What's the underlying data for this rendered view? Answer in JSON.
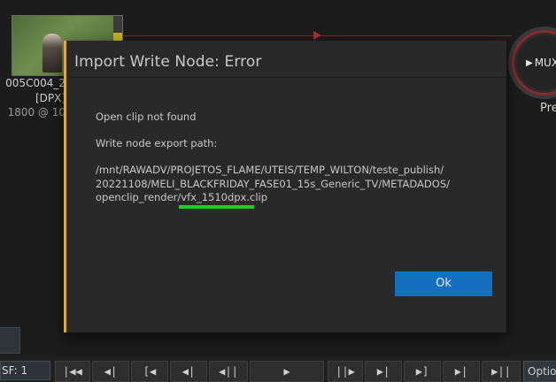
{
  "background": {
    "node_label_line1": "005C004_2",
    "node_label_line2": "[DPX]",
    "node_label_line3": "1800 @ 10",
    "mux_label": "MUX",
    "pre_label": "Pre"
  },
  "dialog": {
    "title": "Import Write Node: Error",
    "message": "Open clip not found",
    "path_label": "Write node export path:",
    "path_line1": "/mnt/RAWADV/PROJETOS_FLAME/UTEIS/TEMP_WILTON/teste_publish/",
    "path_line2": "20221108/MELI_BLACKFRIDAY_FASE01_15s_Generic_TV/METADADOS/",
    "path_line3": "openclip_render/vfx_1510dpx.clip",
    "ok_label": "Ok",
    "accent_color": "#e1a741",
    "ok_color": "#1370c1",
    "highlight_color": "#15d615"
  },
  "transport": {
    "sf_field": "SF: 1",
    "buttons": [
      "|◀◀",
      "◀|",
      "[◀",
      "◀|",
      "◀||",
      "▶",
      "||▶",
      "▶|",
      "▶]",
      "▶|",
      "▶||"
    ],
    "options_label": "Option"
  }
}
